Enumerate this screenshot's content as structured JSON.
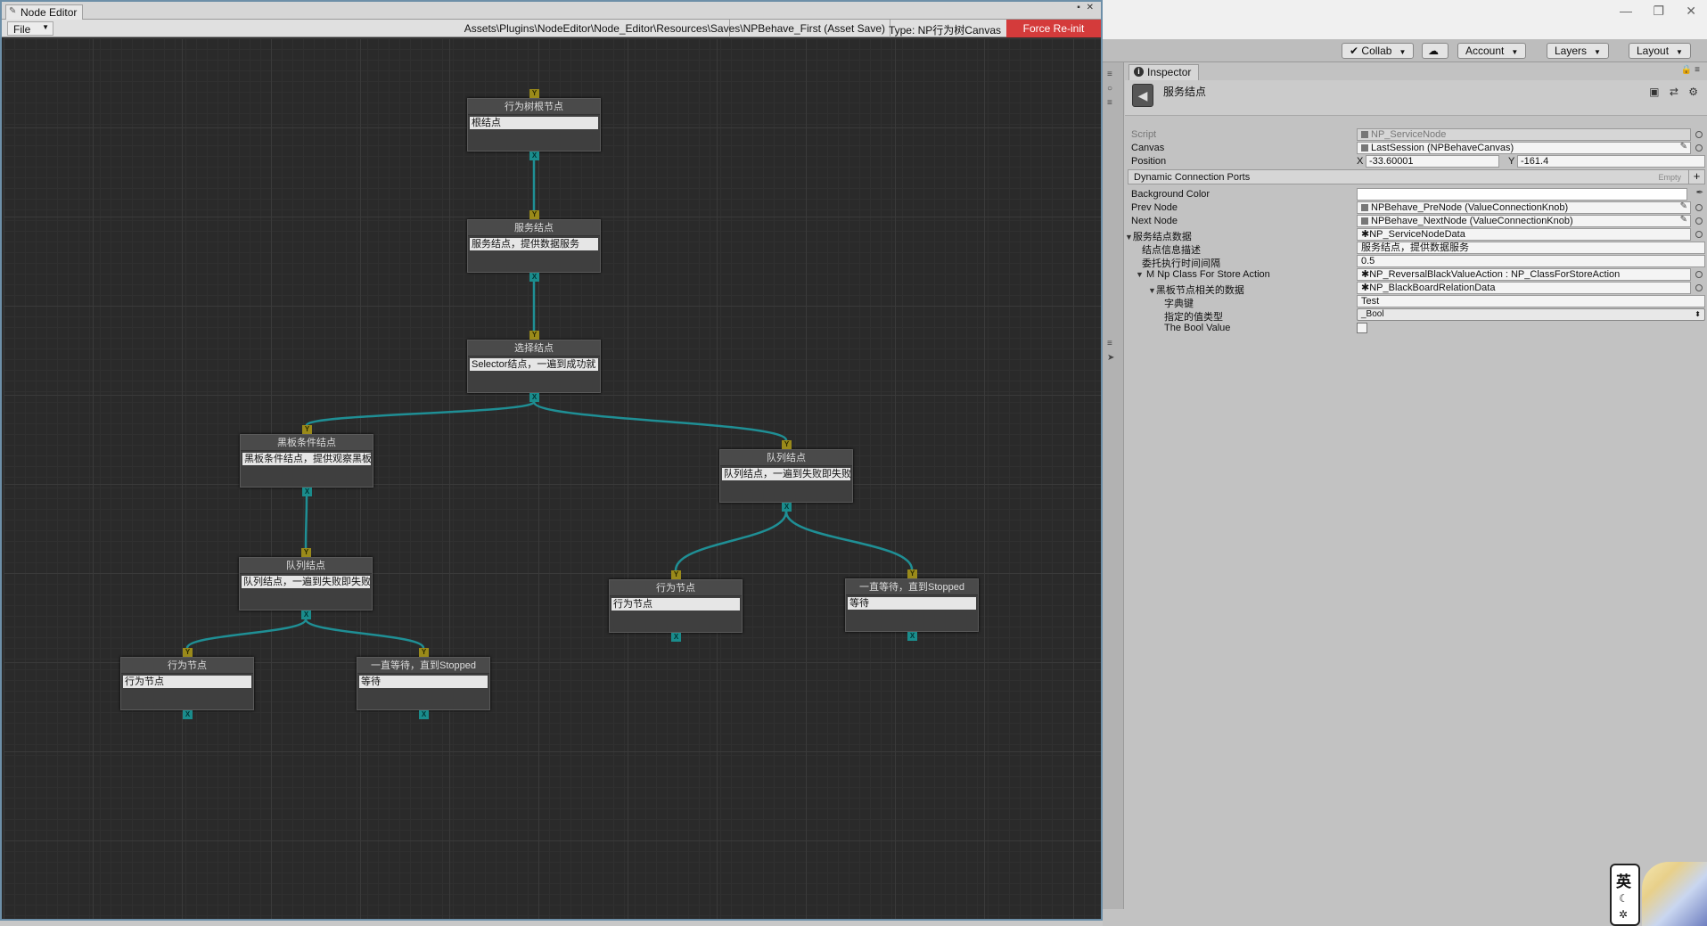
{
  "node_editor": {
    "tab_title": "Node Editor",
    "file_menu": "File",
    "path": "Assets\\Plugins\\NodeEditor\\Node_Editor\\Resources\\Saves\\NPBehave_First (Asset Save)",
    "type_label": "Type: NP行为树Canvas",
    "force_reinit": "Force Re-init",
    "nodes": [
      {
        "id": "n0",
        "title": "行为树根节点",
        "field": "根结点"
      },
      {
        "id": "n1",
        "title": "服务结点",
        "field": "服务结点，提供数据服务"
      },
      {
        "id": "n2",
        "title": "选择结点",
        "field": "Selector结点，一遍到成功就"
      },
      {
        "id": "n3",
        "title": "黑板条件结点",
        "field": "黑板条件结点，提供观察黑板"
      },
      {
        "id": "n4",
        "title": "队列结点",
        "field": "队列结点，一遍到失败即失败"
      },
      {
        "id": "n5",
        "title": "队列结点",
        "field": "队列结点，一遍到失败即失败"
      },
      {
        "id": "n6",
        "title": "行为节点",
        "field": "行为节点"
      },
      {
        "id": "n7",
        "title": "一直等待，直到Stopped",
        "field": "等待"
      },
      {
        "id": "n8",
        "title": "行为节点",
        "field": "行为节点"
      },
      {
        "id": "n9",
        "title": "一直等待，直到Stopped",
        "field": "等待"
      }
    ],
    "edges": [
      [
        "n0",
        "n1"
      ],
      [
        "n1",
        "n2"
      ],
      [
        "n2",
        "n3"
      ],
      [
        "n2",
        "n4"
      ],
      [
        "n3",
        "n5"
      ],
      [
        "n4",
        "n6"
      ],
      [
        "n4",
        "n7"
      ],
      [
        "n5",
        "n8"
      ],
      [
        "n5",
        "n9"
      ]
    ],
    "knob_in_glyph": "Y",
    "knob_out_glyph": "X",
    "colors": {
      "edge": "#1f8f95",
      "knob_in": "#9a8a1a",
      "knob_out": "#1a8c8c",
      "force_btn": "#d43b3b"
    }
  },
  "toolbar": {
    "collab": "Collab",
    "account": "Account",
    "layers": "Layers",
    "layout": "Layout"
  },
  "inspector": {
    "tab": "Inspector",
    "object_name": "服务结点",
    "rows": {
      "script_label": "Script",
      "script_value": "NP_ServiceNode",
      "canvas_label": "Canvas",
      "canvas_value": "LastSession (NPBehaveCanvas)",
      "position_label": "Position",
      "pos_x_label": "X",
      "pos_x": "-33.60001",
      "pos_y_label": "Y",
      "pos_y": "-161.4",
      "dynamic_ports_label": "Dynamic Connection Ports",
      "dynamic_ports_empty": "Empty",
      "bg_color_label": "Background Color",
      "prev_node_label": "Prev Node",
      "prev_node_value": "NPBehave_PreNode (ValueConnectionKnob)",
      "next_node_label": "Next Node",
      "next_node_value": "NPBehave_NextNode (ValueConnectionKnob)",
      "service_data_label": "服务结点数据",
      "service_data_value": "NP_ServiceNodeData",
      "node_desc_label": "结点信息描述",
      "node_desc_value": "服务结点，提供数据服务",
      "interval_label": "委托执行时间间隔",
      "interval_value": "0.5",
      "store_action_label": "M Np Class For Store Action",
      "store_action_value": "NP_ReversalBlackValueAction : NP_ClassForStoreAction",
      "bb_data_label": "黑板节点相关的数据",
      "bb_data_value": "NP_BlackBoardRelationData",
      "dict_key_label": "字典键",
      "dict_key_value": "Test",
      "value_type_label": "指定的值类型",
      "value_type_value": "_Bool",
      "bool_value_label": "The Bool Value"
    }
  },
  "ime": {
    "char": "英"
  }
}
